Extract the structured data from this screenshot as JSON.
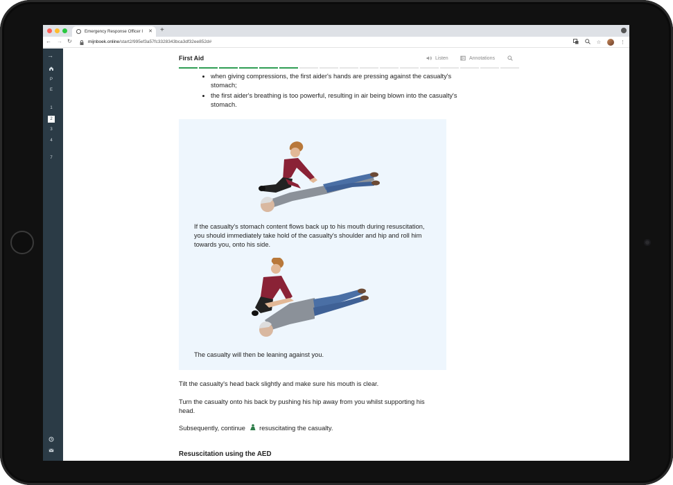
{
  "browser": {
    "tab_title": "Emergency Response Officer I",
    "new_tab_label": "+",
    "url_host": "mijnboek.online",
    "url_path": "/start2/995ef3a57fc3328343bca3df32ee852d#"
  },
  "sidebar": {
    "items": [
      "P",
      "E",
      "1",
      "2",
      "3",
      "4",
      "7"
    ],
    "active_item": "2"
  },
  "header": {
    "title": "First Aid",
    "listen_label": "Listen",
    "annotations_label": "Annotations"
  },
  "progress": {
    "completed_segments": 6,
    "total_segments": 17
  },
  "content": {
    "bullets": [
      "when giving compressions, the first aider's hands are pressing against the casualty's stomach;",
      "the first aider's breathing is too powerful, resulting in air being blown into the casualty's stomach."
    ],
    "caption_1": "If the casualty's stomach content flows back up to his mouth during resuscitation, you should immediately take hold of the casualty's shoulder and hip and roll him towards you, onto his side.",
    "caption_2": "The casualty will then be leaning against you.",
    "para_1": "Tilt the casualty's head back slightly and make sure his mouth is clear.",
    "para_2": "Turn the casualty onto his back by pushing his hip away from you whilst supporting his head.",
    "para_3_before": "Subsequently, continue",
    "para_3_after": "resuscitating the casualty.",
    "section_heading": "Resuscitation using the AED"
  },
  "colors": {
    "sidebar_bg": "#2b3b46",
    "progress_done": "#2e9d53",
    "infobox_bg": "#eef6fd"
  }
}
